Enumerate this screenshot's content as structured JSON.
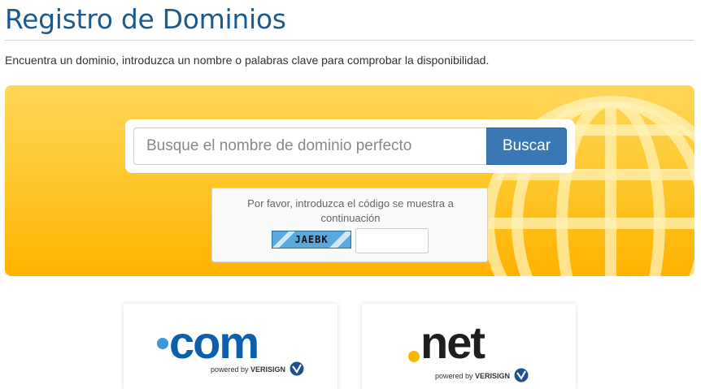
{
  "header": {
    "title": "Registro de Dominios",
    "intro": "Encuentra un dominio, introduzca un nombre o palabras clave para comprobar la disponibilidad."
  },
  "search": {
    "placeholder": "Busque el nombre de dominio perfecto",
    "value": "",
    "button_label": "Buscar"
  },
  "captcha": {
    "prompt": "Por favor, introduzca el código se muestra a continuación",
    "code": "JAEBK",
    "input_value": ""
  },
  "tlds": [
    {
      "name": "com",
      "dot_color": "#3a9ad9",
      "text_color": "#0b5fab",
      "powered_by": "powered by",
      "brand": "VERISIGN"
    },
    {
      "name": "net",
      "dot_color": "#f5b800",
      "text_color": "#1f1f1f",
      "powered_by": "powered by",
      "brand": "VERISIGN"
    }
  ],
  "colors": {
    "title": "#1a5a8f",
    "button": "#3a78b5",
    "banner_top": "#ffd75a",
    "banner_bottom": "#ffb300"
  },
  "icons": {
    "globe": "globe-icon",
    "verisign": "verisign-check-icon"
  }
}
